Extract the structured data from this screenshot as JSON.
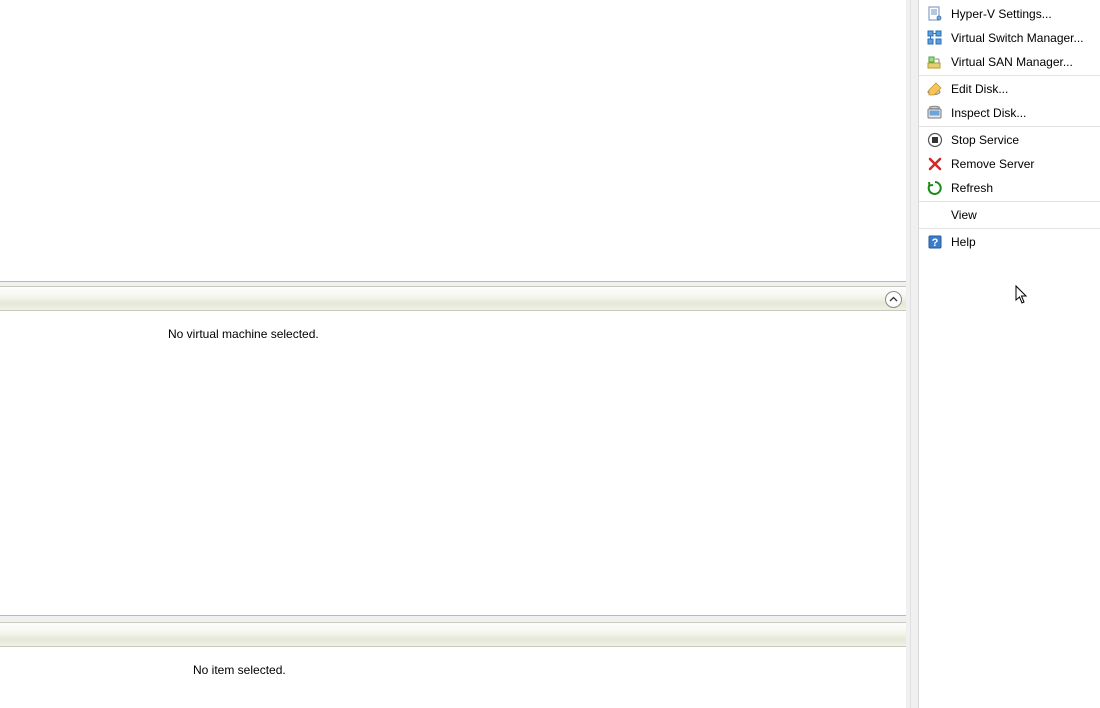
{
  "main": {
    "no_vm_selected": "No virtual machine selected.",
    "no_item_selected": "No item selected."
  },
  "actions": {
    "hyperv_settings": "Hyper-V Settings...",
    "virtual_switch_manager": "Virtual Switch Manager...",
    "virtual_san_manager": "Virtual SAN Manager...",
    "edit_disk": "Edit Disk...",
    "inspect_disk": "Inspect Disk...",
    "stop_service": "Stop Service",
    "remove_server": "Remove Server",
    "refresh": "Refresh",
    "view": "View",
    "help": "Help"
  }
}
